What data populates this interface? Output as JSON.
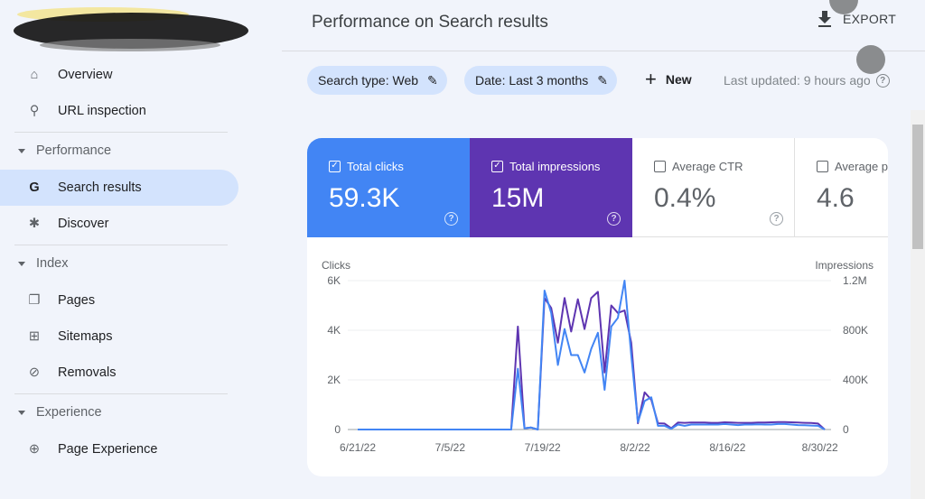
{
  "sidebar": {
    "items": [
      {
        "label": "Overview",
        "icon": "home-icon"
      },
      {
        "label": "URL inspection",
        "icon": "search-icon"
      }
    ],
    "sections": [
      {
        "label": "Performance",
        "items": [
          {
            "label": "Search results",
            "icon": "google-g-icon",
            "active": true
          },
          {
            "label": "Discover",
            "icon": "asterisk-icon"
          }
        ]
      },
      {
        "label": "Index",
        "items": [
          {
            "label": "Pages",
            "icon": "pages-icon"
          },
          {
            "label": "Sitemaps",
            "icon": "sitemap-icon"
          },
          {
            "label": "Removals",
            "icon": "eye-off-icon"
          }
        ]
      },
      {
        "label": "Experience",
        "items": [
          {
            "label": "Page Experience",
            "icon": "plus-circle-icon"
          }
        ]
      }
    ]
  },
  "header": {
    "title": "Performance on Search results",
    "export_label": "EXPORT"
  },
  "filters": {
    "chips": [
      "Search type: Web",
      "Date: Last 3 months"
    ],
    "new_label": "New",
    "last_updated": "Last updated: 9 hours ago"
  },
  "metrics": [
    {
      "name": "Total clicks",
      "value": "59.3K",
      "checked": true,
      "color": "#4285f4"
    },
    {
      "name": "Total impressions",
      "value": "15M",
      "checked": true,
      "color": "#5e35b1"
    },
    {
      "name": "Average CTR",
      "value": "0.4%",
      "checked": false
    },
    {
      "name": "Average po",
      "value": "4.6",
      "checked": false
    }
  ],
  "chart_data": {
    "type": "line",
    "y_left_label": "Clicks",
    "y_right_label": "Impressions",
    "y_left_ticks": [
      "0",
      "2K",
      "4K",
      "6K"
    ],
    "y_right_ticks": [
      "0",
      "400K",
      "800K",
      "1.2M"
    ],
    "ylim_left": [
      0,
      6000
    ],
    "ylim_right": [
      0,
      1200000
    ],
    "x_ticks": [
      "6/21/22",
      "7/5/22",
      "7/19/22",
      "8/2/22",
      "8/16/22",
      "8/30/22"
    ],
    "x_start": "6/21/22",
    "x_end": "8/31/22",
    "grid": true,
    "series": [
      {
        "name": "Clicks",
        "axis": "left",
        "color": "#4285f4",
        "values": [
          0,
          0,
          0,
          0,
          0,
          0,
          0,
          0,
          0,
          0,
          0,
          0,
          0,
          0,
          0,
          0,
          0,
          0,
          0,
          0,
          0,
          0,
          0,
          0,
          2450,
          50,
          80,
          0,
          5600,
          4700,
          2600,
          4050,
          3000,
          3000,
          2300,
          3250,
          3900,
          1600,
          4150,
          4500,
          6000,
          3000,
          300,
          1150,
          1300,
          150,
          150,
          30,
          200,
          150,
          200,
          200,
          200,
          200,
          200,
          220,
          200,
          180,
          200,
          200,
          210,
          200,
          200,
          220,
          220,
          200,
          180,
          170,
          160,
          150,
          0
        ]
      },
      {
        "name": "Impressions",
        "axis": "right",
        "color": "#5e35b1",
        "values": [
          0,
          0,
          0,
          0,
          0,
          0,
          0,
          0,
          0,
          0,
          0,
          0,
          0,
          0,
          0,
          0,
          0,
          0,
          0,
          0,
          0,
          0,
          0,
          0,
          830000,
          10000,
          16000,
          0,
          1060000,
          980000,
          700000,
          1060000,
          790000,
          1050000,
          810000,
          1060000,
          1110000,
          460000,
          1000000,
          940000,
          960000,
          700000,
          50000,
          300000,
          240000,
          50000,
          48000,
          10000,
          56000,
          54000,
          56000,
          56000,
          56000,
          54000,
          54000,
          58000,
          56000,
          54000,
          54000,
          54000,
          56000,
          56000,
          58000,
          60000,
          60000,
          58000,
          56000,
          54000,
          52000,
          48000,
          0
        ]
      }
    ]
  }
}
